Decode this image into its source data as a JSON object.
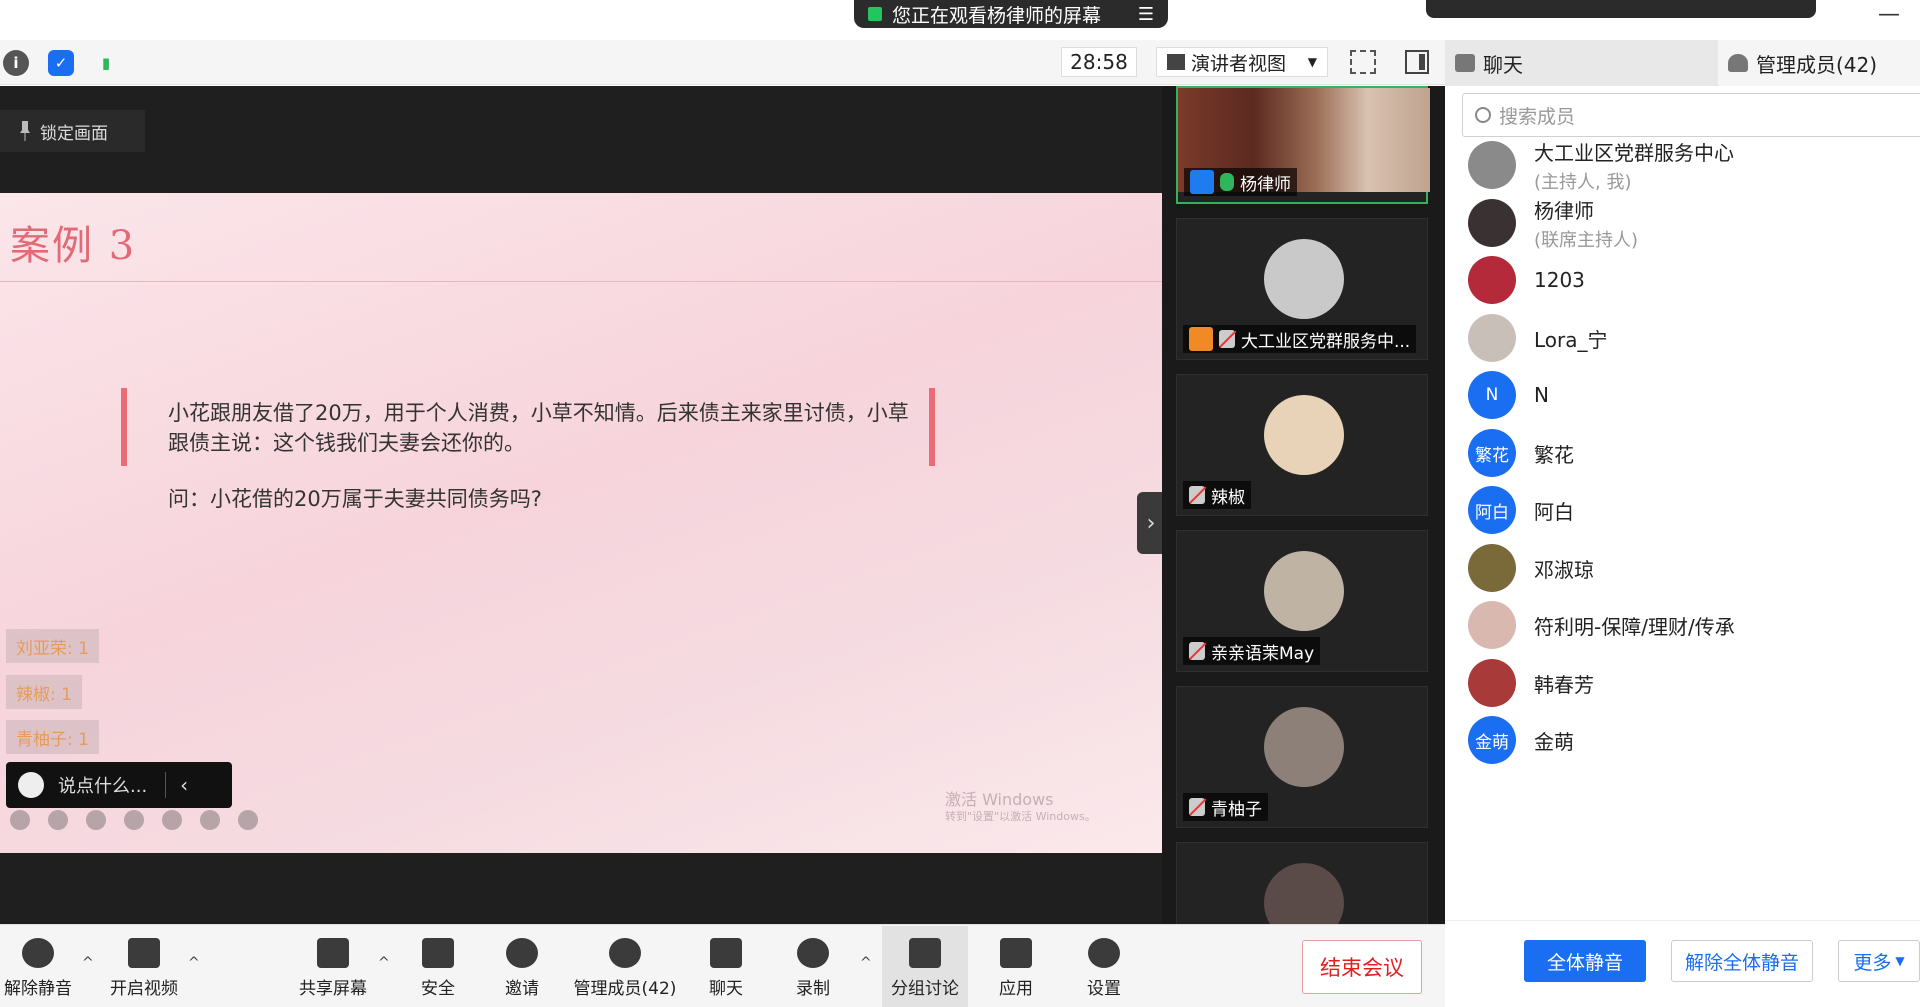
{
  "banner": {
    "text": "您正在观看杨律师的屏幕"
  },
  "toolbar": {
    "timer": "28:58",
    "view_mode": "演讲者视图"
  },
  "tabs": {
    "chat": "聊天",
    "members": "管理成员(42)"
  },
  "stage": {
    "lock_label": "锁定画面",
    "slide_title": "案例 3",
    "slide_text": "小花跟朋友借了20万，用于个人消费，小草不知情。后来债主来家里讨债，小草跟债主说：这个钱我们夫妻会还你的。",
    "slide_question": "问：小花借的20万属于夫妻共同债务吗?",
    "watermark": "激活 Windows",
    "watermark_sub": "转到\"设置\"以激活 Windows。",
    "reactions": [
      "刘亚荣: 1",
      "辣椒: 1",
      "青柚子: 1"
    ],
    "chat_placeholder": "说点什么..."
  },
  "tiles": [
    {
      "name": "杨律师"
    },
    {
      "name": "大工业区党群服务中..."
    },
    {
      "name": "辣椒"
    },
    {
      "name": "亲亲语茉May"
    },
    {
      "name": "青柚子"
    }
  ],
  "members": {
    "search_placeholder": "搜索成员",
    "list": [
      {
        "name": "大工业区党群服务中心",
        "role": "(主持人, 我)",
        "avatar_color": "#8a8a8a",
        "avatar_text": ""
      },
      {
        "name": "杨律师",
        "role": "(联席主持人)",
        "avatar_color": "#3a3232",
        "avatar_text": ""
      },
      {
        "name": "1203",
        "role": "",
        "avatar_color": "#b52a3a",
        "avatar_text": ""
      },
      {
        "name": "Lora_宁",
        "role": "",
        "avatar_color": "#c8c0b8",
        "avatar_text": ""
      },
      {
        "name": "N",
        "role": "",
        "avatar_color": "#1a6ef2",
        "avatar_text": "N"
      },
      {
        "name": "繁花",
        "role": "",
        "avatar_color": "#1a6ef2",
        "avatar_text": "繁花"
      },
      {
        "name": "阿白",
        "role": "",
        "avatar_color": "#1a6ef2",
        "avatar_text": "阿白"
      },
      {
        "name": "邓淑琼",
        "role": "",
        "avatar_color": "#7a6a3a",
        "avatar_text": ""
      },
      {
        "name": "符利明-保障/理财/传承",
        "role": "",
        "avatar_color": "#d9b8b0",
        "avatar_text": ""
      },
      {
        "name": "韩春芳",
        "role": "",
        "avatar_color": "#a83a3a",
        "avatar_text": ""
      },
      {
        "name": "金萌",
        "role": "",
        "avatar_color": "#1a6ef2",
        "avatar_text": "金萌"
      }
    ]
  },
  "bottombar": {
    "unmute": "解除静音",
    "video": "开启视频",
    "share": "共享屏幕",
    "security": "安全",
    "invite": "邀请",
    "manage": "管理成员(42)",
    "chat": "聊天",
    "record": "录制",
    "breakout": "分组讨论",
    "apps": "应用",
    "settings": "设置",
    "end": "结束会议"
  },
  "member_actions": {
    "mute_all": "全体静音",
    "unmute_all": "解除全体静音",
    "more": "更多"
  }
}
